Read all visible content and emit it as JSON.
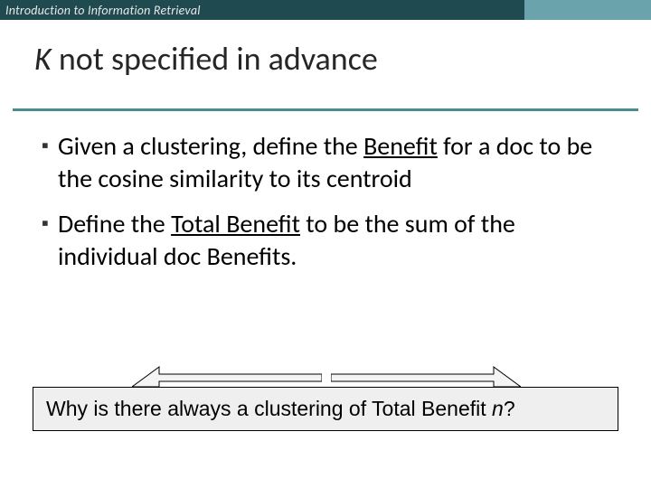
{
  "header": {
    "tag": "Introduction to Information Retrieval"
  },
  "title": {
    "k": "K",
    "rest": " not specified in advance"
  },
  "bullets": [
    {
      "pre": "Given a clustering, define the ",
      "u": "Benefit",
      "post": " for a doc to be the cosine similarity to its centroid"
    },
    {
      "pre": "Define the ",
      "u": "Total Benefit",
      "post": " to be the sum of the individual doc Benefits."
    }
  ],
  "callout": {
    "text1": "Why is there always a clustering of Total Benefit ",
    "n": "n",
    "text2": "?"
  }
}
